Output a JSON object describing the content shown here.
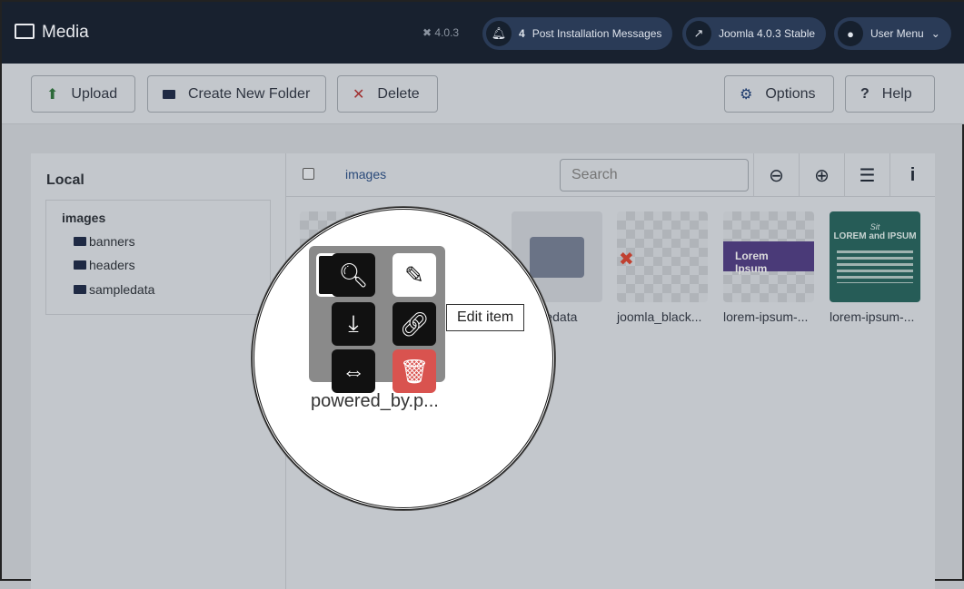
{
  "header": {
    "title": "Media",
    "version": "4.0.3",
    "notifications_count": "4",
    "post_install": "Post Installation Messages",
    "joomla_version": "Joomla 4.0.3 Stable",
    "user_menu": "User Menu"
  },
  "toolbar": {
    "upload": "Upload",
    "new_folder": "Create New Folder",
    "delete": "Delete",
    "options": "Options",
    "help": "Help"
  },
  "tree": {
    "heading": "Local",
    "root": "images",
    "items": [
      "banners",
      "headers",
      "sampledata"
    ]
  },
  "browser": {
    "breadcrumb": "images",
    "search_placeholder": "Search",
    "items": [
      {
        "name": "powered_by.p..."
      },
      {
        "name": "sampledata"
      },
      {
        "name": "joomla_black..."
      },
      {
        "name": "lorem-ipsum-..."
      },
      {
        "name": "lorem-ipsum-..."
      }
    ]
  },
  "magnifier": {
    "tooltip": "Edit item",
    "item_name": "powered_by.p...",
    "folder_name_partial": "edata",
    "actions": [
      "preview",
      "edit",
      "download",
      "share-link",
      "resize",
      "delete"
    ]
  },
  "thumb_text": {
    "banner": "Lorem Ipsum",
    "sit": "Sit",
    "lorem_and_ipsum": "LOREM and IPSUM"
  },
  "colors": {
    "header": "#18212f",
    "delete_action": "#d9534f",
    "teal_thumb": "#265c57",
    "purple_thumb": "#4a3a78"
  }
}
